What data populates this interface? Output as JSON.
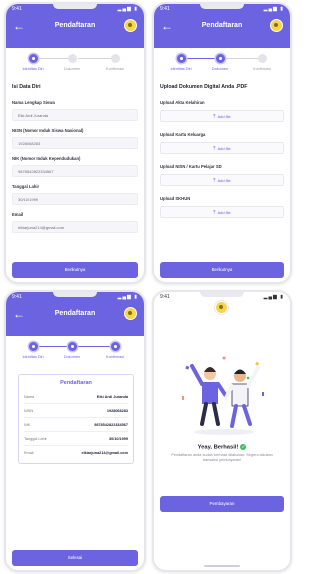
{
  "colors": {
    "primary": "#6c63e0",
    "success": "#3cbf5a",
    "input_bg": "#f6f6fa"
  },
  "status": {
    "time": "9:41",
    "icons": "signal-wifi-battery"
  },
  "steps": [
    "Identitas Diri",
    "Dokumen",
    "Konfirmasi"
  ],
  "screen1": {
    "title": "Pendaftaran",
    "section": "Isi Data Diri",
    "active_step": 1,
    "fields": [
      {
        "label": "Nama Lengkap Siswa",
        "value": "Eiki Ardi Juranda"
      },
      {
        "label": "NISN (Nomor Induk Siswa Nasional)",
        "value": "1928068283"
      },
      {
        "label": "NIK (Nomor Induk Kependudukan)",
        "value": "9878542822334567"
      },
      {
        "label": "Tanggal Lahir",
        "value": "30/10/1999"
      },
      {
        "label": "Email",
        "value": "elkiarjuna214@gmail.com"
      }
    ],
    "button": "Berikutnya"
  },
  "screen2": {
    "title": "Pendaftaran",
    "section": "Upload Dokumen Digital Anda .PDF",
    "active_step": 2,
    "uploads": [
      {
        "label": "Upload Akta Kelahiran",
        "action": "Add file"
      },
      {
        "label": "Upload Kartu Keluarga",
        "action": "Add file"
      },
      {
        "label": "Upload NISN / Kartu Pelajar SD",
        "action": "Add file"
      },
      {
        "label": "Upload SKHUN",
        "action": "Add file"
      }
    ],
    "button": "Berikutnya"
  },
  "screen3": {
    "title": "Pendaftaran",
    "active_step": 3,
    "card_title": "Pendaftaran",
    "rows": [
      {
        "key": "Nama",
        "value": "Eiki Ardi Juranda"
      },
      {
        "key": "NISN",
        "value": "1928068283"
      },
      {
        "key": "NIK",
        "value": "9878542822334567"
      },
      {
        "key": "Tanggal Lahir",
        "value": "30/10/1999"
      },
      {
        "key": "Email",
        "value": "elkiarjuna214@gmail.com"
      }
    ],
    "button": "Selesai"
  },
  "screen4": {
    "success_title": "Yeay, Berhasil!",
    "success_message": "Pendaftaran anda sudah berhasil dilakukan. Segera lakukan transaksi pembayaran!",
    "button": "Pembayaran",
    "illustration": "celebrating-people"
  }
}
